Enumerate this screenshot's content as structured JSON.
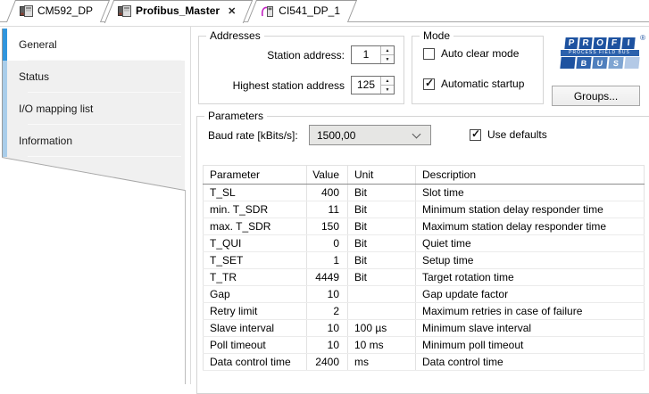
{
  "tabs": [
    {
      "label": "CM592_DP",
      "icon": "device-module-icon",
      "active": false,
      "closable": false
    },
    {
      "label": "Profibus_Master",
      "icon": "device-module-icon",
      "active": true,
      "closable": true
    },
    {
      "label": "CI541_DP_1",
      "icon": "device-cable-icon",
      "active": false,
      "closable": false
    }
  ],
  "close_glyph": "✕",
  "sidebar": {
    "items": [
      {
        "label": "General",
        "selected": true
      },
      {
        "label": "Status",
        "selected": false
      },
      {
        "label": "I/O mapping list",
        "selected": false
      },
      {
        "label": "Information",
        "selected": false
      }
    ]
  },
  "addresses": {
    "title": "Addresses",
    "station_address": {
      "label": "Station address:",
      "value": "1"
    },
    "highest_station_address": {
      "label": "Highest station address",
      "value": "125"
    }
  },
  "mode": {
    "title": "Mode",
    "auto_clear": {
      "label": "Auto clear mode",
      "checked": false
    },
    "auto_startup": {
      "label": "Automatic startup",
      "checked": true
    }
  },
  "logo": {
    "letters_top": [
      "P",
      "R",
      "O",
      "F",
      "I"
    ],
    "registered": "®",
    "bar_text": "PROCESS FIELD BUS",
    "letters_bottom": [
      "",
      "B",
      "U",
      "S",
      ""
    ],
    "tile_colors_bottom": [
      "#1d52a0",
      "#2e63ad",
      "#4f7fbd",
      "#7fa5d2",
      "#b3c9e6"
    ]
  },
  "groups_button": "Groups...",
  "parameters": {
    "title": "Parameters",
    "baud_rate_label": "Baud rate [kBits/s]:",
    "baud_rate_value": "1500,00",
    "use_defaults": {
      "label": "Use defaults",
      "checked": true
    },
    "table": {
      "columns": [
        "Parameter",
        "Value",
        "Unit",
        "Description"
      ],
      "rows": [
        [
          "T_SL",
          "400",
          "Bit",
          "Slot time"
        ],
        [
          "min. T_SDR",
          "11",
          "Bit",
          "Minimum station delay responder time"
        ],
        [
          "max. T_SDR",
          "150",
          "Bit",
          "Maximum station delay responder time"
        ],
        [
          "T_QUI",
          "0",
          "Bit",
          "Quiet time"
        ],
        [
          "T_SET",
          "1",
          "Bit",
          "Setup time"
        ],
        [
          "T_TR",
          "4449",
          "Bit",
          "Target rotation time"
        ],
        [
          "Gap",
          "10",
          "",
          "Gap update factor"
        ],
        [
          "Retry limit",
          "2",
          "",
          "Maximum retries in case of failure"
        ],
        [
          "Slave interval",
          "10",
          "100 µs",
          "Minimum slave interval"
        ],
        [
          "Poll timeout",
          "10",
          "10 ms",
          "Minimum poll timeout"
        ],
        [
          "Data control time",
          "2400",
          "ms",
          "Data control time"
        ]
      ]
    }
  },
  "colors": {
    "accent_selected": "#3095dd",
    "accent_strip": "#a9cdea",
    "logo_blue": "#1d52a0"
  }
}
